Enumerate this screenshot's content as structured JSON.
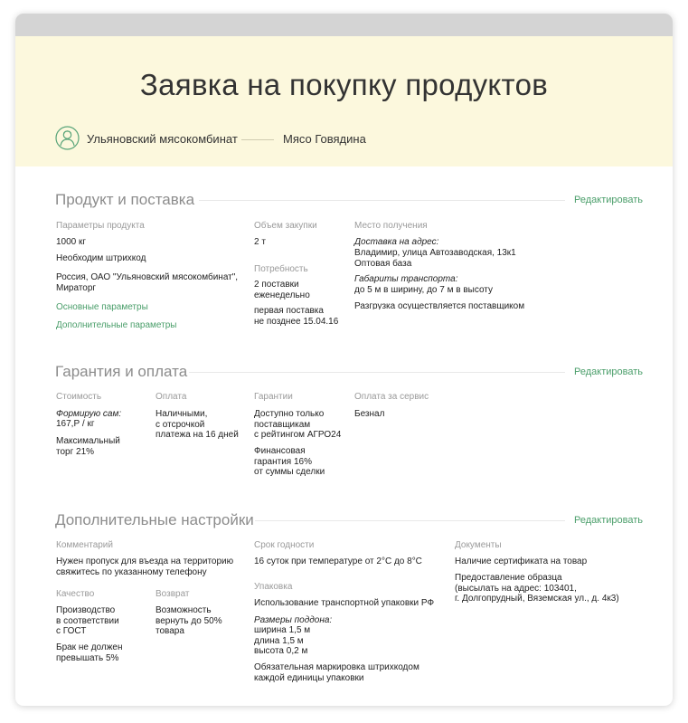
{
  "header": {
    "title": "Заявка на покупку продуктов",
    "company": "Ульяновский мясокомбинат",
    "product": "Мясо Говядина"
  },
  "edit_label": "Редактировать",
  "section1": {
    "title": "Продукт и поставка",
    "params_label": "Параметры продукта",
    "weight": "1000 кг",
    "barcode": "Необходим штрихкод",
    "origin": "Россия, ОАО \"Ульяновский мясокомбинат\", Мираторг",
    "main_params_link": "Основные параметры",
    "extra_params_link": "Дополнительные параметры",
    "volume_label": "Объем закупки",
    "volume_value": "2 т",
    "need_label": "Потребность",
    "need_value": "2 поставки\nеженедельно",
    "first_supply": "первая поставка\nне позднее 15.04.16",
    "place_label": "Место получения",
    "delivery_title": "Доставка на адрес:",
    "delivery_address": "Владимир, улица Автозаводская, 13к1\nОптовая база",
    "transport_title": "Габариты транспорта:",
    "transport_value": "до 5 м в ширину, до 7 м в высоту",
    "unloading": "Разгрузка осуществляется поставщиком"
  },
  "section2": {
    "title": "Гарантия и оплата",
    "cost_label": "Стоимость",
    "cost_title": "Формирую сам:",
    "cost_value": "167,Р / кг",
    "bargain": "Максимальный\nторг 21%",
    "payment_label": "Оплата",
    "payment_value": "Наличными,\nс отсрочкой\nплатежа на 16 дней",
    "guarantee_label": "Гарантии",
    "guarantee_value": "Доступно только\nпоставщикам\nс рейтингом АГРО24",
    "financial": "Финансовая\nгарантия 16%\nот суммы сделки",
    "service_label": "Оплата за сервис",
    "service_value": "Безнал"
  },
  "section3": {
    "title": "Дополнительные настройки",
    "comment_label": "Комментарий",
    "comment_value": "Нужен пропуск для въезда на территорию\nсвяжитесь по указанному телефону",
    "quality_label": "Качество",
    "quality_value": "Производство\nв соответствии\nс ГОСТ",
    "defect": "Брак не должен\nпревышать 5%",
    "return_label": "Возврат",
    "return_value": "Возможность\nвернуть до 50%\nтовара",
    "shelf_label": "Срок годности",
    "shelf_value": "16 суток при температуре от 2°С до 8°С",
    "pack_label": "Упаковка",
    "pack_value": "Использование транспортной упаковки РФ",
    "pallet_title": "Размеры поддона:",
    "pallet_value": "ширина 1,5 м\nдлина 1,5 м\nвысота 0,2 м",
    "marking": "Обязательная маркировка штрихкодом\nкаждой единицы упаковки",
    "docs_label": "Документы",
    "docs_value": "Наличие сертификата на товар",
    "sample": "Предоставление образца\n(высылать на адрес: 103401,\nг. Долгопрудный, Вяземская ул., д. 4к3)"
  }
}
